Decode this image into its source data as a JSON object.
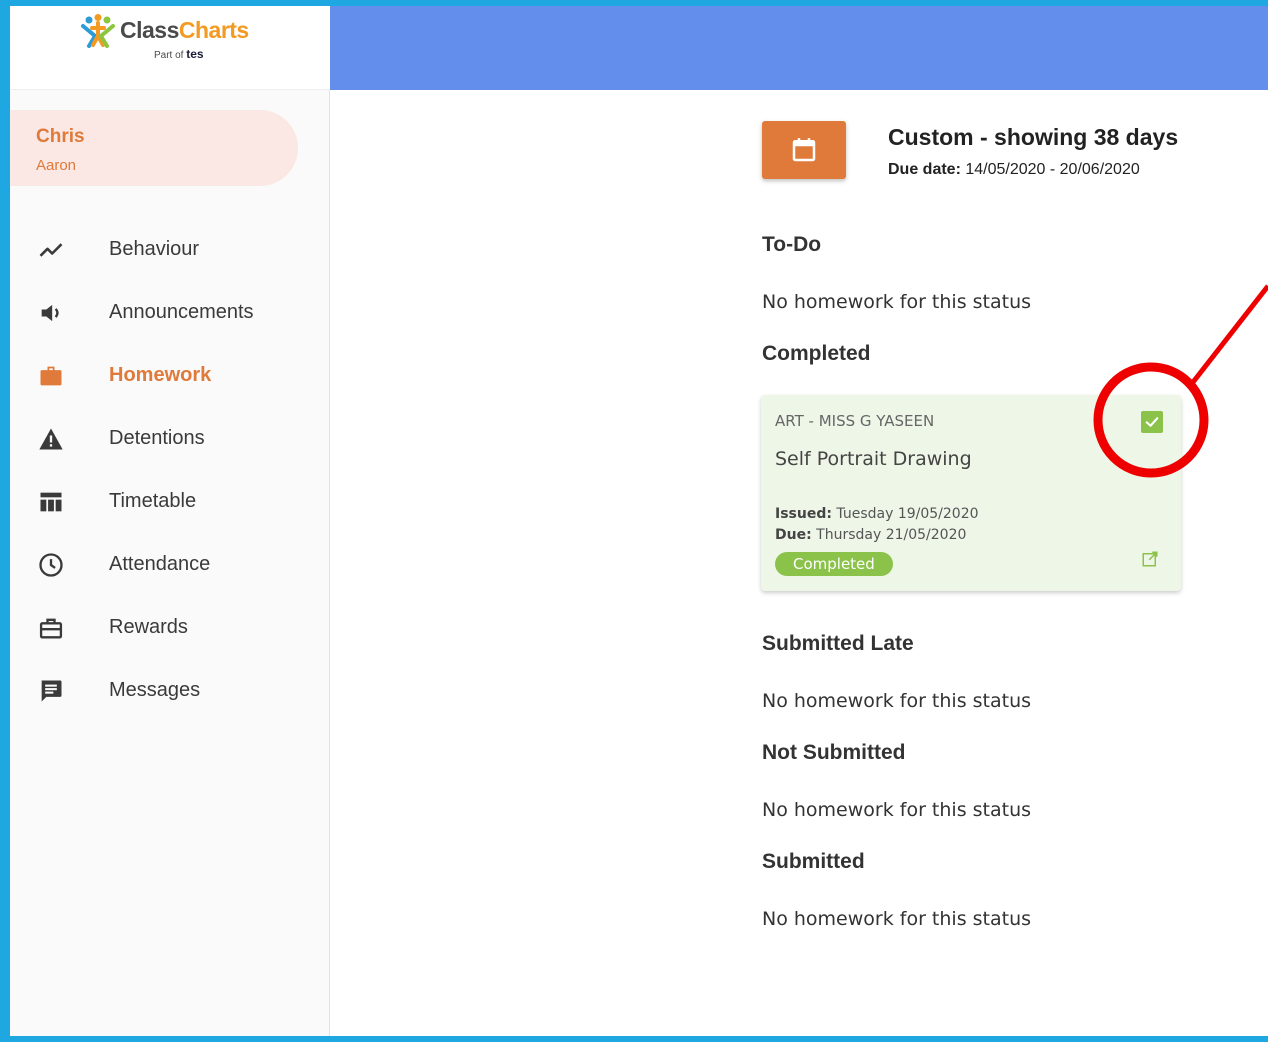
{
  "brand": {
    "name_part1": "Class",
    "name_part2": "Charts",
    "sub_prefix": "Part of",
    "sub_brand": "tes",
    "accent": "#e07a3a",
    "topbar_color": "#638eec"
  },
  "user": {
    "first_name": "Chris",
    "last_name": "Aaron"
  },
  "sidebar": {
    "items": [
      {
        "label": "Behaviour",
        "icon": "trend-line-icon"
      },
      {
        "label": "Announcements",
        "icon": "speaker-icon"
      },
      {
        "label": "Homework",
        "icon": "briefcase-icon",
        "active": true
      },
      {
        "label": "Detentions",
        "icon": "warning-icon"
      },
      {
        "label": "Timetable",
        "icon": "table-icon"
      },
      {
        "label": "Attendance",
        "icon": "clock-icon"
      },
      {
        "label": "Rewards",
        "icon": "gift-icon"
      },
      {
        "label": "Messages",
        "icon": "message-icon"
      }
    ]
  },
  "filter": {
    "title": "Custom - showing 38 days",
    "due_label": "Due date:",
    "due_range": "14/05/2020 - 20/06/2020"
  },
  "sections": {
    "todo": {
      "title": "To-Do",
      "empty": "No homework for this status"
    },
    "completed": {
      "title": "Completed"
    },
    "submitted_late": {
      "title": "Submitted Late",
      "empty": "No homework for this status"
    },
    "not_submitted": {
      "title": "Not Submitted",
      "empty": "No homework for this status"
    },
    "submitted": {
      "title": "Submitted",
      "empty": "No homework for this status"
    }
  },
  "homework_card": {
    "subject": "ART - MISS G YASEEN",
    "title": "Self Portrait Drawing",
    "issued_label": "Issued:",
    "issued_value": "Tuesday 19/05/2020",
    "due_label": "Due:",
    "due_value": "Thursday 21/05/2020",
    "status": "Completed",
    "checked": true
  }
}
